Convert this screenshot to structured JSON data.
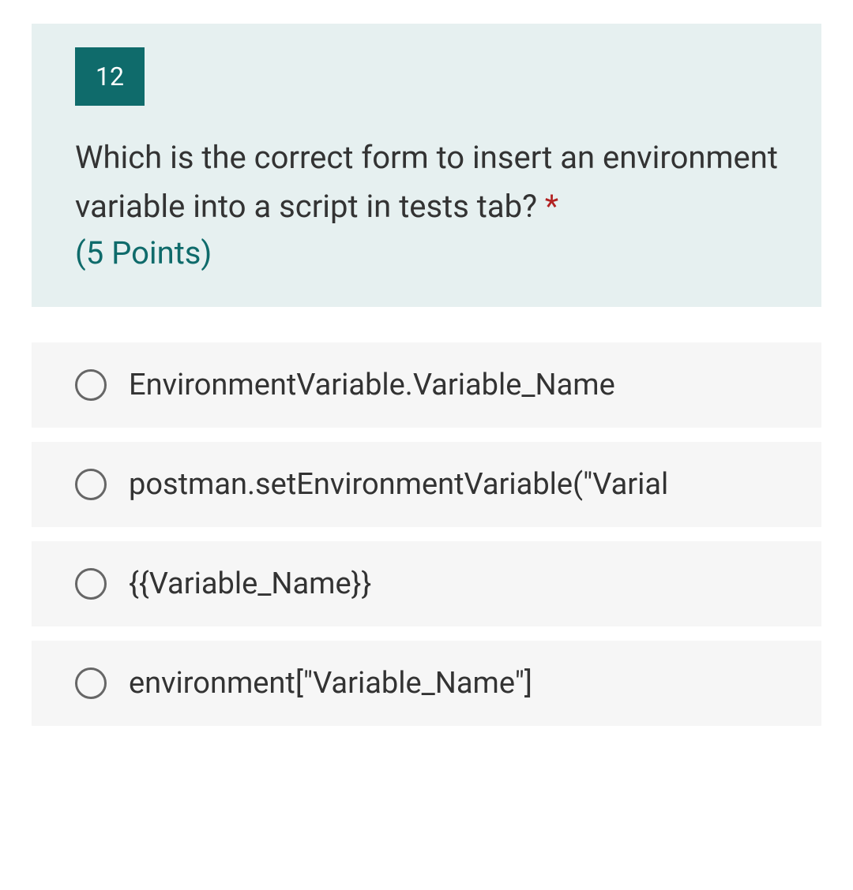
{
  "question": {
    "number": "12",
    "text": "Which is the correct form to insert an environment variable into a script in tests tab?",
    "required_marker": "*",
    "points": "(5 Points)"
  },
  "options": [
    {
      "label": "EnvironmentVariable.Variable_Name"
    },
    {
      "label": "postman.setEnvironmentVariable(\"Varial"
    },
    {
      "label": "{{Variable_Name}}"
    },
    {
      "label": "environment[\"Variable_Name\"]"
    }
  ]
}
